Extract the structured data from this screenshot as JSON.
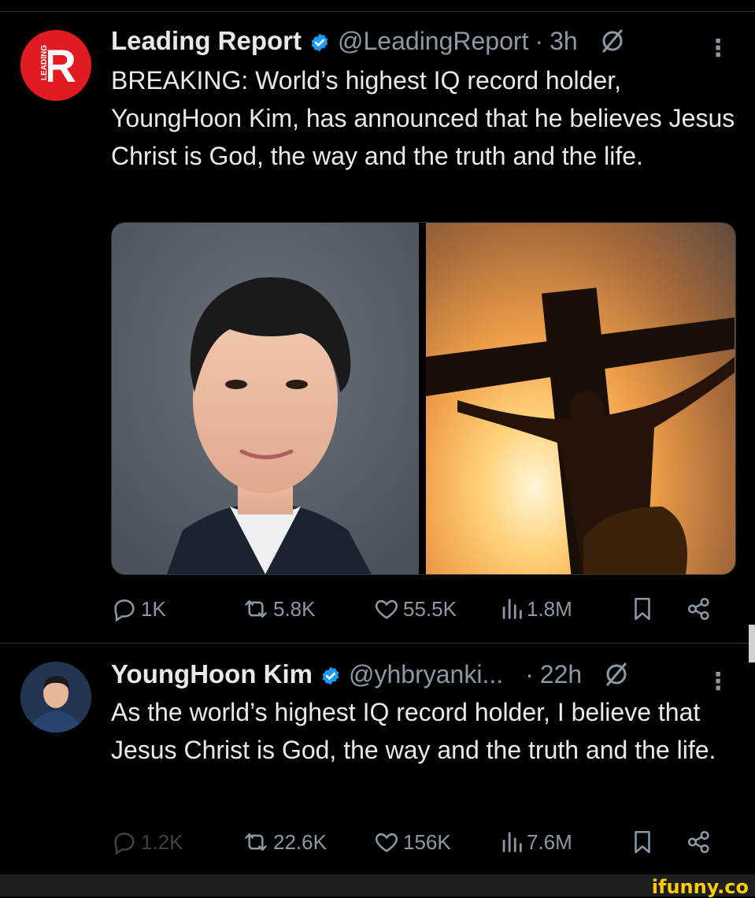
{
  "tweets": [
    {
      "display_name": "Leading Report",
      "handle": "@LeadingReport",
      "separator": "·",
      "time": "3h",
      "more": "⋮",
      "text": "BREAKING: World’s highest IQ record holder, YoungHoon Kim, has announced that he believes Jesus Christ is God, the way and the truth and the life.",
      "avatar_letter": "R",
      "avatar_side_text": "LEADING",
      "stats": {
        "replies": "1K",
        "reposts": "5.8K",
        "likes": "55.5K",
        "views": "1.8M"
      }
    },
    {
      "display_name": "YoungHoon Kim",
      "handle": "@yhbryanki...",
      "separator": "·",
      "time": "22h",
      "more": "⋮",
      "text": "As the world’s highest IQ record holder, I believe that Jesus Christ is God, the way and the truth and the life.",
      "stats": {
        "replies": "1.2K",
        "reposts": "22.6K",
        "likes": "156K",
        "views": "7.6M"
      }
    }
  ],
  "watermark": "ifunny.co",
  "colors": {
    "background": "#000000",
    "text": "#e7e9ea",
    "muted": "#8b98a5",
    "verified": "#1d9bf0",
    "avatar_red": "#e01b22",
    "watermark": "#ffcc00"
  },
  "icons": [
    "verified-badge-icon",
    "grok-icon",
    "more-icon",
    "reply-icon",
    "repost-icon",
    "like-icon",
    "views-icon",
    "bookmark-icon",
    "share-icon"
  ]
}
